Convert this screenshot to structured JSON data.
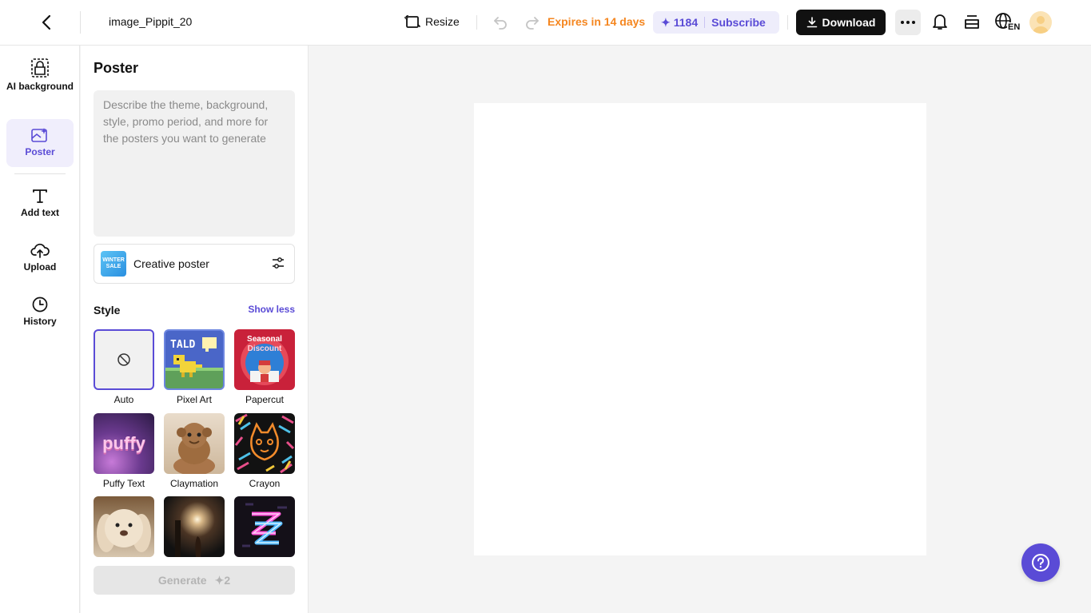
{
  "topbar": {
    "file_name": "image_Pippit_20",
    "resize_label": "Resize",
    "expires_text": "Expires in 14 days",
    "credits_count": "1184",
    "subscribe_label": "Subscribe",
    "download_label": "Download",
    "language": "EN",
    "accent_color": "#5a4bd6",
    "warning_color": "#f5861f"
  },
  "rail": {
    "items": [
      {
        "label": "AI background",
        "icon": "ai-background-icon"
      },
      {
        "label": "Poster",
        "icon": "poster-icon",
        "active": true
      },
      {
        "label": "Add text",
        "icon": "text-icon"
      },
      {
        "label": "Upload",
        "icon": "upload-icon"
      },
      {
        "label": "History",
        "icon": "history-icon"
      }
    ]
  },
  "panel": {
    "title": "Poster",
    "prompt_placeholder": "Describe the theme, background, style, promo period, and more for the posters you want to generate",
    "poster_type": "Creative poster",
    "poster_type_thumb_lines": [
      "WINTER",
      "SALE"
    ],
    "style_heading": "Style",
    "show_less_label": "Show less",
    "styles": [
      {
        "name": "Auto",
        "selected": true
      },
      {
        "name": "Pixel Art",
        "thumb_text": "TALD"
      },
      {
        "name": "Papercut",
        "thumb_lines": [
          "Seasonal",
          "Discount"
        ]
      },
      {
        "name": "Puffy Text",
        "thumb_text": "puffy"
      },
      {
        "name": "Claymation"
      },
      {
        "name": "Crayon"
      },
      {
        "name": ""
      },
      {
        "name": ""
      },
      {
        "name": ""
      }
    ],
    "generate_label": "Generate",
    "generate_cost": "2"
  }
}
